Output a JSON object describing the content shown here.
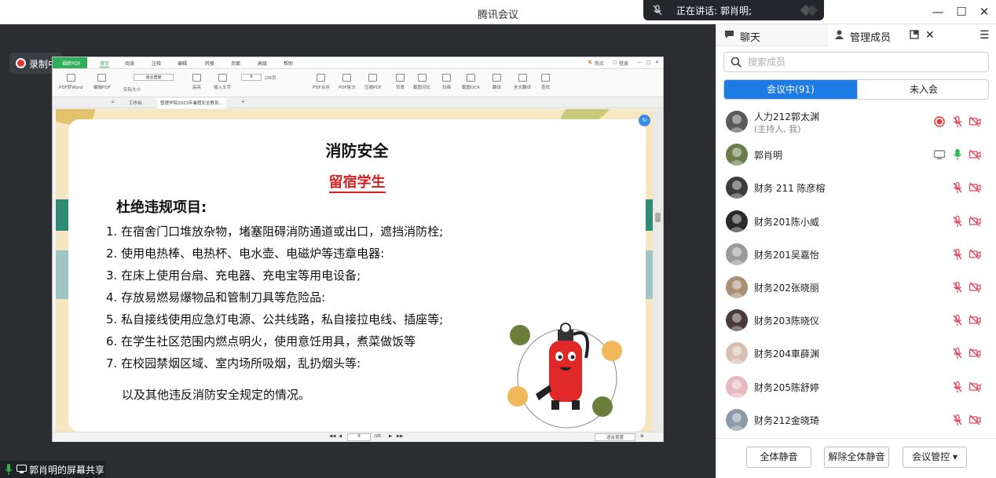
{
  "window": {
    "title": "腾讯会议"
  },
  "speaking": {
    "label": "正在讲话:",
    "name": "郭肖明;"
  },
  "recording": {
    "label": "录制中"
  },
  "share_info": {
    "label": "郭肖明的屏幕共享"
  },
  "pdf_app": {
    "brand": "福昕PDF",
    "menu": [
      "首页",
      "阅读",
      "注释",
      "编辑",
      "转换",
      "页面",
      "高级",
      "帮助"
    ],
    "active_menu": "首页",
    "top_right": [
      "购买",
      "登录"
    ],
    "toolbar": {
      "pdf_to_word": "PDF转Word",
      "edit_pdf": "编辑PDF",
      "zoom_mode": "适合宽度",
      "actual_size": "实际大小",
      "highlight": "高亮",
      "insert_text": "插入文字",
      "page_current": "9",
      "page_total": "/26页",
      "pdf_merge": "PDF合并",
      "pdf_split": "PDF拆分",
      "compress": "压缩PDF",
      "crop": "背景",
      "compare": "截图对比",
      "scan": "扫描",
      "ocr": "截图OCR",
      "translate": "翻译",
      "full_translate": "全文翻译",
      "find": "查找"
    },
    "doc_tabs": {
      "home": "工作台",
      "current": "管理学院2023年暑假安全教育..."
    },
    "status": {
      "page": "9",
      "total": "/26",
      "zoom": "适合宽度"
    }
  },
  "slide": {
    "title": "消防安全",
    "subtitle": "留宿学生",
    "heading": "杜绝违规项目:",
    "items": [
      "1. 在宿舍门口堆放杂物，堵塞阻碍消防通道或出口，遮挡消防栓;",
      "2. 使用电热棒、电热杯、电水壶、电磁炉等违章电器:",
      "3. 在床上使用台扇、充电器、充电宝等用电设备;",
      "4. 存放易燃易爆物品和管制刀具等危险品:",
      "5. 私自接线使用应急灯电源、公共线路，私自接拉电线、插座等;",
      "6. 在学生社区范围内燃点明火，使用意饪用具，煮菜做饭等",
      "7. 在校园禁烟区域、室内场所吸烟，乱扔烟头等:"
    ],
    "footer": "以及其他违反消防安全规定的情况。"
  },
  "sidebar": {
    "tabs": {
      "chat": "聊天",
      "members": "管理成员"
    },
    "search_placeholder": "搜索成员",
    "segment": {
      "in_meeting": "会议中(91)",
      "not_joined": "未入会"
    },
    "members": [
      {
        "name": "人力212郭太渊",
        "sub": "(主持人, 我)",
        "recording": true,
        "screen": false,
        "mic_on": false
      },
      {
        "name": "郭肖明",
        "sub": "",
        "recording": false,
        "screen": true,
        "mic_on": true
      },
      {
        "name": "财务 211 陈彦榕",
        "sub": "",
        "recording": false,
        "screen": false,
        "mic_on": false
      },
      {
        "name": "财务201陈小威",
        "sub": "",
        "recording": false,
        "screen": false,
        "mic_on": false
      },
      {
        "name": "财务201吴嘉怡",
        "sub": "",
        "recording": false,
        "screen": false,
        "mic_on": false
      },
      {
        "name": "财务202张晓丽",
        "sub": "",
        "recording": false,
        "screen": false,
        "mic_on": false
      },
      {
        "name": "财务203陈晓仪",
        "sub": "",
        "recording": false,
        "screen": false,
        "mic_on": false
      },
      {
        "name": "财务204車薛渊",
        "sub": "",
        "recording": false,
        "screen": false,
        "mic_on": false
      },
      {
        "name": "财务205陈舒婷",
        "sub": "",
        "recording": false,
        "screen": false,
        "mic_on": false
      },
      {
        "name": "财务212金晓琦",
        "sub": "",
        "recording": false,
        "screen": false,
        "mic_on": false
      }
    ],
    "footer": {
      "mute_all": "全体静音",
      "unmute_all": "解除全体静音",
      "controls": "会议管控"
    }
  },
  "colors": {
    "accent": "#1e7be3",
    "muted_red": "#e0485a",
    "mic_green": "#2db84c",
    "slide_red": "#d32020"
  }
}
